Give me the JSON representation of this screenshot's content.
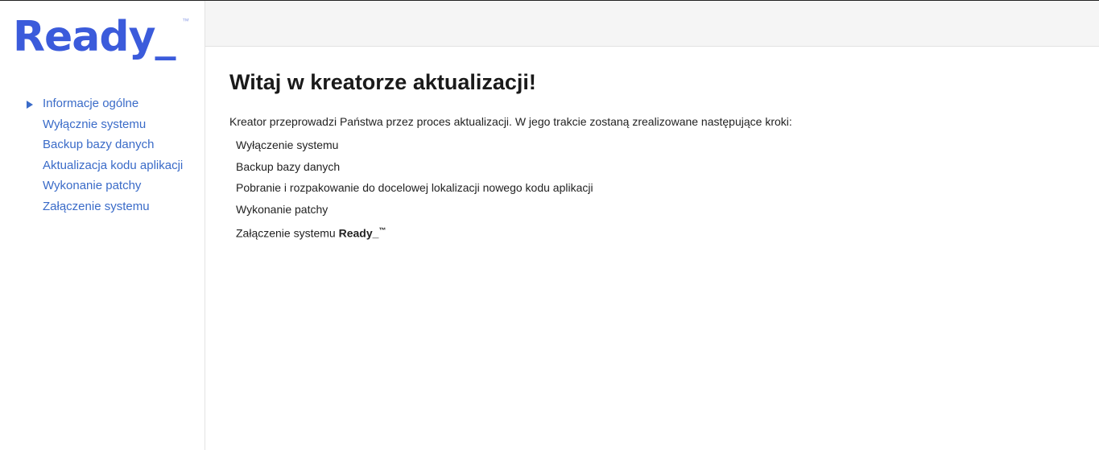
{
  "logo": {
    "text": "Ready_",
    "tm": "™"
  },
  "sidebar": {
    "items": [
      {
        "label": "Informacje ogólne",
        "active": true
      },
      {
        "label": "Wyłącznie systemu",
        "active": false
      },
      {
        "label": "Backup bazy danych",
        "active": false
      },
      {
        "label": "Aktualizacja kodu aplikacji",
        "active": false
      },
      {
        "label": "Wykonanie patchy",
        "active": false
      },
      {
        "label": "Załączenie systemu",
        "active": false
      }
    ]
  },
  "main": {
    "title": "Witaj w kreatorze aktualizacji!",
    "intro": "Kreator przeprowadzi Państwa przez proces aktualizacji. W jego trakcie zostaną zrealizowane następujące kroki:",
    "steps": [
      "Wyłączenie systemu",
      "Backup bazy danych",
      "Pobranie i rozpakowanie do docelowej lokalizacji nowego kodu aplikacji",
      "Wykonanie patchy"
    ],
    "last_step_prefix": "Załączenie systemu ",
    "last_step_brand": "Ready_",
    "last_step_tm": "™"
  },
  "colors": {
    "brand": "#3b5bdb",
    "link": "#3a6bc8",
    "topbar": "#f5f5f5"
  },
  "icons": {
    "active_marker": "triangle-right-icon"
  }
}
